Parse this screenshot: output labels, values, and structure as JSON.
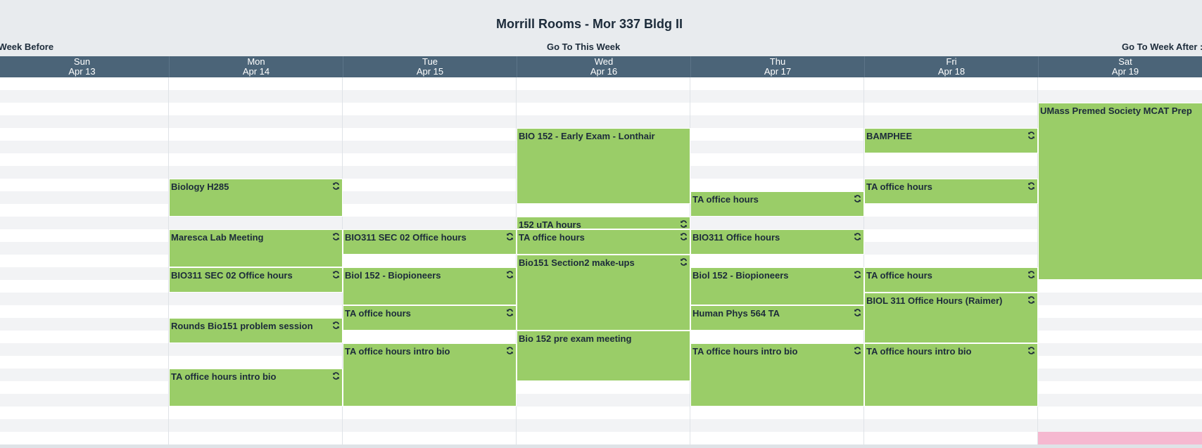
{
  "title": "Morrill Rooms - Mor 337 Bldg II",
  "nav": {
    "prev": "To Week Before",
    "this": "Go To This Week",
    "next": "Go To Week After :"
  },
  "days": [
    {
      "dow": "Sun",
      "date": "Apr 13"
    },
    {
      "dow": "Mon",
      "date": "Apr 14"
    },
    {
      "dow": "Tue",
      "date": "Apr 15"
    },
    {
      "dow": "Wed",
      "date": "Apr 16"
    },
    {
      "dow": "Thu",
      "date": "Apr 17"
    },
    {
      "dow": "Fri",
      "date": "Apr 18"
    },
    {
      "dow": "Sat",
      "date": "Apr 19"
    }
  ],
  "colors": {
    "event": "#9acd68",
    "header": "#4b6478",
    "pink_event": "#f6b8d0"
  },
  "recurring_icon": "refresh-icon",
  "events": [
    {
      "day": 6,
      "start": 2,
      "end": 16,
      "label": "UMass Premed Society MCAT Prep",
      "recurring": true
    },
    {
      "day": 3,
      "start": 4,
      "end": 10,
      "label": "BIO 152 - Early Exam - Lonthair",
      "recurring": false
    },
    {
      "day": 5,
      "start": 4,
      "end": 6,
      "label": "BAMPHEE",
      "recurring": true
    },
    {
      "day": 1,
      "start": 8,
      "end": 11,
      "label": "Biology H285",
      "recurring": true
    },
    {
      "day": 5,
      "start": 8,
      "end": 10,
      "label": "TA office hours",
      "recurring": true
    },
    {
      "day": 4,
      "start": 9,
      "end": 11,
      "label": "TA office hours",
      "recurring": true
    },
    {
      "day": 3,
      "start": 11,
      "end": 12,
      "label": "152 uTA hours",
      "recurring": true
    },
    {
      "day": 1,
      "start": 12,
      "end": 15,
      "label": "Maresca Lab Meeting",
      "recurring": true
    },
    {
      "day": 2,
      "start": 12,
      "end": 14,
      "label": "BIO311 SEC 02 Office hours",
      "recurring": true
    },
    {
      "day": 3,
      "start": 12,
      "end": 14,
      "label": "TA office hours",
      "recurring": true
    },
    {
      "day": 4,
      "start": 12,
      "end": 14,
      "label": "BIO311 Office hours",
      "recurring": true
    },
    {
      "day": 3,
      "start": 14,
      "end": 20,
      "label": "Bio151 Section2 make-ups",
      "recurring": true
    },
    {
      "day": 1,
      "start": 15,
      "end": 17,
      "label": "BIO311 SEC 02 Office hours",
      "recurring": true
    },
    {
      "day": 2,
      "start": 15,
      "end": 18,
      "label": "Biol 152 - Biopioneers",
      "recurring": true
    },
    {
      "day": 4,
      "start": 15,
      "end": 18,
      "label": "Biol 152 - Biopioneers",
      "recurring": true
    },
    {
      "day": 5,
      "start": 15,
      "end": 17,
      "label": "TA office hours",
      "recurring": true
    },
    {
      "day": 5,
      "start": 17,
      "end": 21,
      "label": "BIOL 311 Office Hours (Raimer)",
      "recurring": true
    },
    {
      "day": 2,
      "start": 18,
      "end": 20,
      "label": "TA office hours",
      "recurring": true
    },
    {
      "day": 4,
      "start": 18,
      "end": 20,
      "label": "Human Phys 564 TA",
      "recurring": true
    },
    {
      "day": 1,
      "start": 19,
      "end": 21,
      "label": "Rounds Bio151 problem session",
      "recurring": true
    },
    {
      "day": 3,
      "start": 20,
      "end": 24,
      "label": "Bio 152 pre exam meeting",
      "recurring": false
    },
    {
      "day": 2,
      "start": 21,
      "end": 26,
      "label": "TA office hours intro bio",
      "recurring": true
    },
    {
      "day": 4,
      "start": 21,
      "end": 26,
      "label": "TA office hours intro bio",
      "recurring": true
    },
    {
      "day": 5,
      "start": 21,
      "end": 26,
      "label": "TA office hours intro bio",
      "recurring": true
    },
    {
      "day": 1,
      "start": 23,
      "end": 26,
      "label": "TA office hours intro bio",
      "recurring": true
    }
  ],
  "pink_events": [
    {
      "day": 6,
      "start": 28,
      "end": 29
    }
  ]
}
